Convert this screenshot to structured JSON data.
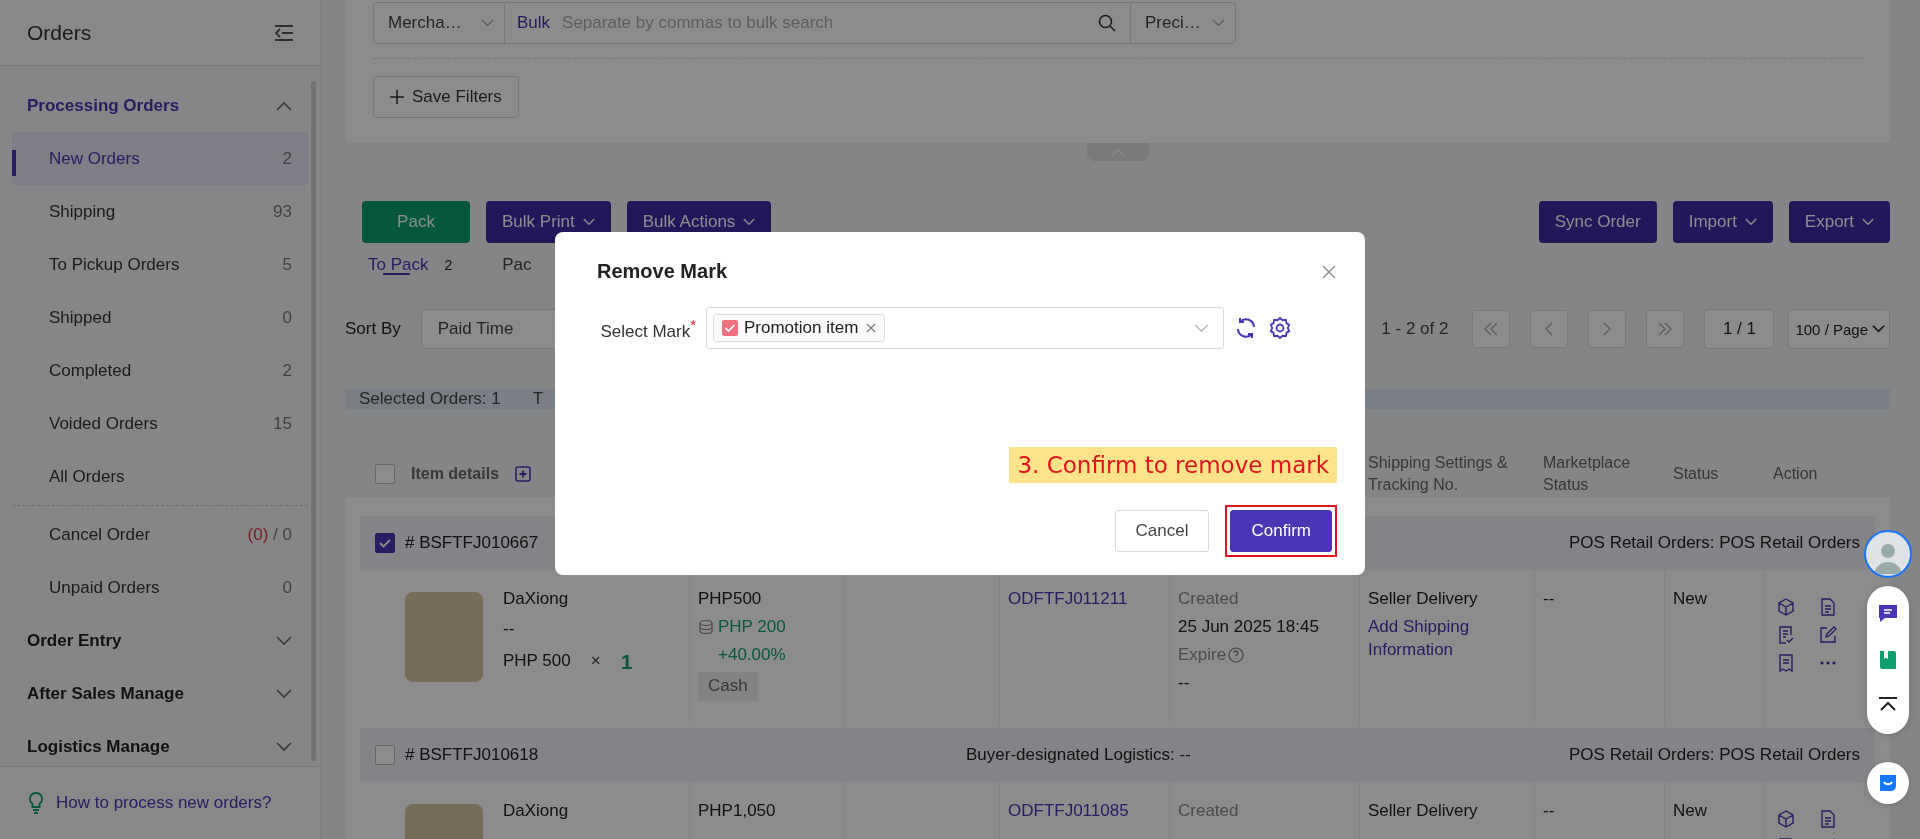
{
  "sidebar": {
    "title": "Orders",
    "groups": [
      {
        "label": "Processing Orders",
        "expanded": true,
        "items": [
          {
            "label": "New Orders",
            "count": "2",
            "selected": true,
            "divider_before": false
          },
          {
            "label": "Shipping",
            "count": "93",
            "selected": false,
            "divider_before": false
          },
          {
            "label": "To Pickup Orders",
            "count": "5",
            "selected": false,
            "divider_before": false
          },
          {
            "label": "Shipped",
            "count": "0",
            "selected": false,
            "divider_before": false
          },
          {
            "label": "Completed",
            "count": "2",
            "selected": false,
            "divider_before": false
          },
          {
            "label": "Voided Orders",
            "count": "15",
            "selected": false,
            "divider_before": false
          },
          {
            "label": "All Orders",
            "selected": false,
            "divider_before": false
          },
          {
            "label": "Cancel Order",
            "pending": "(0)",
            "count": "/ 0",
            "selected": false,
            "divider_before": true
          },
          {
            "label": "Unpaid Orders",
            "count": "0",
            "selected": false,
            "divider_before": false
          }
        ]
      },
      {
        "label": "Order Entry",
        "expanded": false
      },
      {
        "label": "After Sales Manage",
        "expanded": false
      },
      {
        "label": "Logistics Manage",
        "expanded": false
      }
    ],
    "help_link": "How to process new orders?"
  },
  "filters": {
    "merchant_select": "Mercha…",
    "bulk_label": "Bulk",
    "search_placeholder": "Separate by commas to bulk search",
    "match_select": "Preci…",
    "save_button": "Save Filters"
  },
  "toolbar": {
    "left": [
      {
        "label": "Pack",
        "kind": "action"
      },
      {
        "label": "Bulk Print",
        "kind": "menu"
      },
      {
        "label": "Bulk Actions",
        "kind": "menu"
      }
    ],
    "right": [
      {
        "label": "Sync Order",
        "kind": "action"
      },
      {
        "label": "Import",
        "kind": "menu"
      },
      {
        "label": "Export",
        "kind": "menu"
      }
    ]
  },
  "tabs": [
    {
      "label": "To Pack",
      "count": "2",
      "selected": true
    },
    {
      "label": "Pac",
      "selected": false
    }
  ],
  "sort": {
    "label": "Sort By",
    "value": "Paid Time"
  },
  "pager": {
    "range": "1 - 2 of 2",
    "page": "1 / 1",
    "page_size": "100 / Page"
  },
  "selection_bar": {
    "text": "Selected Orders: 1",
    "column_2": "T"
  },
  "table": {
    "select_all_checked": false,
    "columns": [
      {
        "label": "Item details"
      },
      {
        "label": "Shipping Settings & Tracking No."
      },
      {
        "label": "Marketplace Status"
      },
      {
        "label": "Status"
      },
      {
        "label": "Action"
      }
    ],
    "orders": [
      {
        "number": "# BSFTFJ010667",
        "checked": true,
        "order_type": "POS Retail Orders: POS Retail Orders",
        "product": {
          "name": "DaXiong",
          "variant": "--",
          "price": "PHP 500",
          "times": "×",
          "quantity": "1"
        },
        "amount": {
          "total": "PHP500",
          "profit": "PHP 200",
          "margin": "+40.00%",
          "payment": "Cash"
        },
        "order_no": "ODFTFJ011211",
        "time": {
          "label": "Created",
          "value": "25 Jun 2025 18:45",
          "expire_label": "Expire",
          "expire_value": "--"
        },
        "shipping": {
          "method": "Seller Delivery",
          "link": "Add Shipping Information"
        },
        "marketplace_status": "--",
        "status": "New"
      },
      {
        "number": "# BSFTFJ010618",
        "checked": false,
        "logistics": "Buyer-designated Logistics: --",
        "order_type": "POS Retail Orders: POS Retail Orders",
        "product": {
          "name": "DaXiong"
        },
        "amount": {
          "total": "PHP1,050"
        },
        "order_no": "ODFTFJ011085",
        "time": {
          "label": "Created"
        },
        "shipping": {
          "method": "Seller Delivery"
        },
        "marketplace_status": "--",
        "status": "New"
      }
    ]
  },
  "modal": {
    "title": "Remove Mark",
    "field_label": "Select Mark",
    "required_mark": "*",
    "tags": [
      {
        "label": "Promotion item"
      }
    ],
    "annotation": "3. Confirm to remove mark",
    "buttons": [
      {
        "label": "Cancel",
        "kind": "secondary",
        "highlighted": false
      },
      {
        "label": "Confirm",
        "kind": "primary",
        "highlighted": true
      }
    ]
  }
}
